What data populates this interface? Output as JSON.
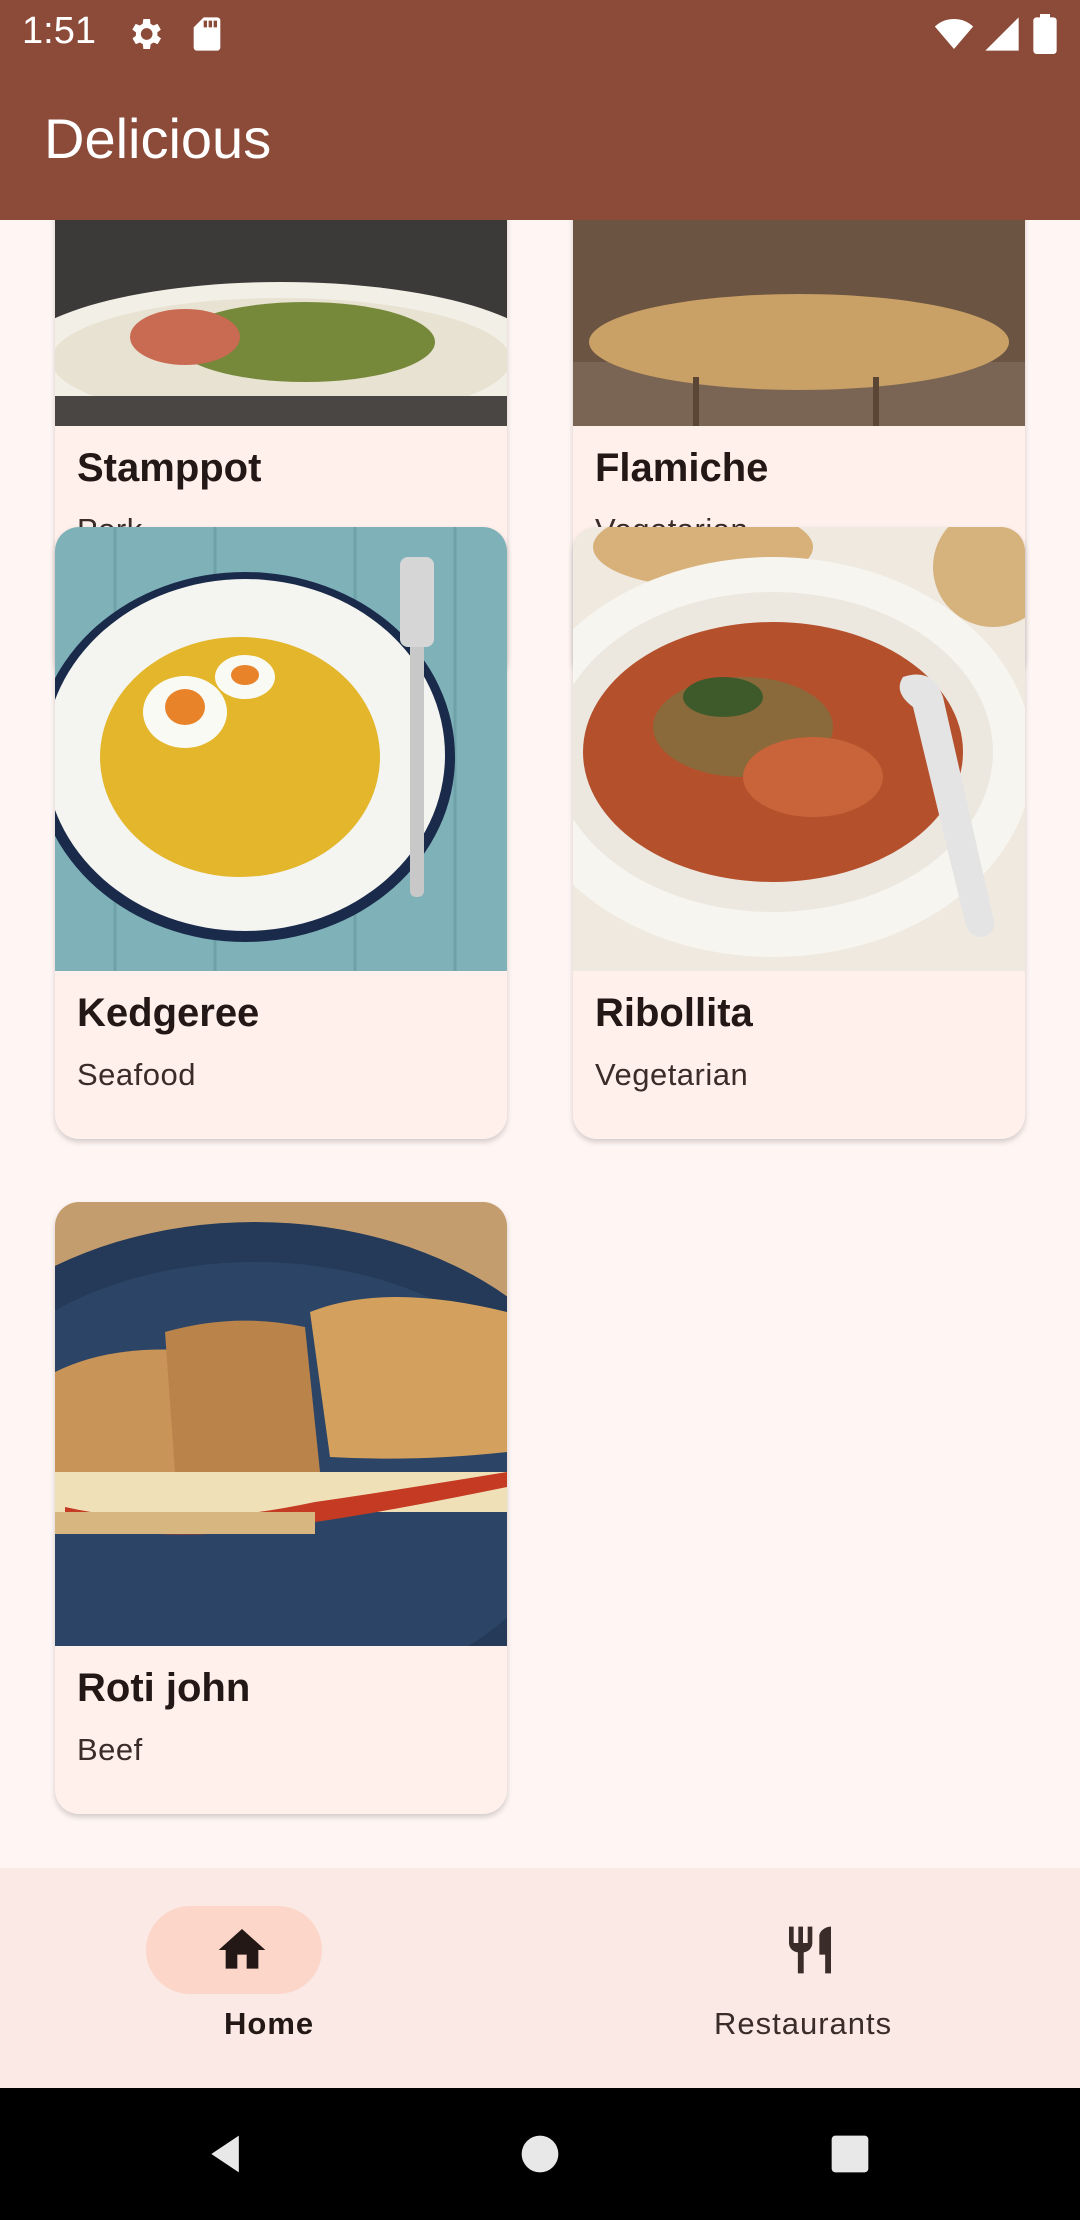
{
  "status_bar": {
    "time": "1:51"
  },
  "app_bar": {
    "title": "Delicious"
  },
  "recipes": [
    {
      "name": "Stamppot",
      "category": "Pork"
    },
    {
      "name": "Flamiche",
      "category": "Vegetarian"
    },
    {
      "name": "Kedgeree",
      "category": "Seafood"
    },
    {
      "name": "Ribollita",
      "category": "Vegetarian"
    },
    {
      "name": "Roti john",
      "category": "Beef"
    }
  ],
  "bottom_nav": {
    "items": [
      {
        "label": "Home",
        "icon": "home-icon",
        "selected": true
      },
      {
        "label": "Restaurants",
        "icon": "restaurant-icon",
        "selected": false
      }
    ]
  },
  "colors": {
    "primary": "#8c4a38",
    "background": "#fff6f4",
    "card": "#fff0ec",
    "nav_indicator": "#fdd6ca"
  }
}
